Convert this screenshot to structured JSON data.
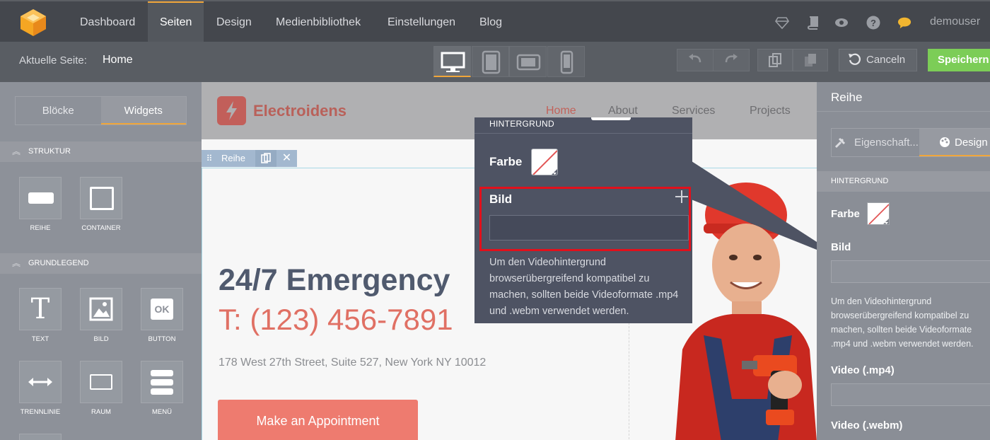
{
  "topnav": {
    "items": [
      "Dashboard",
      "Seiten",
      "Design",
      "Medienbibliothek",
      "Einstellungen",
      "Blog"
    ],
    "active": "Seiten",
    "username": "demouser",
    "icons": [
      "diamond-icon",
      "book-icon",
      "eye-icon",
      "help-icon",
      "chat-icon"
    ],
    "accent_color": "#f0a63a"
  },
  "toolbar": {
    "current_label": "Aktuelle Seite:",
    "current_page": "Home",
    "devices": [
      "desktop-icon",
      "tablet-portrait-icon",
      "tablet-landscape-icon",
      "phone-icon"
    ],
    "active_device": "desktop-icon",
    "cancel_label": "Canceln",
    "save_label": "Speichern",
    "save_color": "#7ccd57"
  },
  "leftpanel": {
    "tabs": [
      "Blöcke",
      "Widgets"
    ],
    "active_tab": "Widgets",
    "sections": [
      {
        "title": "STRUKTUR",
        "items": [
          "REIHE",
          "CONTAINER"
        ]
      },
      {
        "title": "GRUNDLEGEND",
        "items": [
          "TEXT",
          "BILD",
          "BUTTON",
          "TRENNLINIE",
          "RAUM",
          "MENÜ"
        ]
      }
    ]
  },
  "site": {
    "brand": "Electroidens",
    "nav": [
      "Home",
      "About",
      "Services",
      "Projects"
    ],
    "active_nav": "Home",
    "row_tag": "Reihe",
    "headline": "24/7 Emergency",
    "phone": "T: (123) 456-7891",
    "address": "178 West 27th Street, Suite 527, New York NY 10012",
    "cta": "Make an Appointment"
  },
  "popup": {
    "section": "HINTERGRUND",
    "color_label": "Farbe",
    "image_label": "Bild",
    "image_value": "",
    "help_text": "Um den Videohintergrund browserübergreifend kompatibel zu machen, sollten beide Videoformate .mp4 und .webm verwendet werden."
  },
  "rightpanel": {
    "title": "Reihe",
    "tabs": [
      "Eigenschaft...",
      "Design"
    ],
    "active_tab": "Design",
    "section": "HINTERGRUND",
    "color_label": "Farbe",
    "image_label": "Bild",
    "help_text": "Um den Videohintergrund browserübergreifend kompatibel zu machen, sollten beide Videoformate .mp4 und .webm verwendet werden.",
    "video_mp4_label": "Video (.mp4)",
    "video_webm_label": "Video (.webm)"
  }
}
